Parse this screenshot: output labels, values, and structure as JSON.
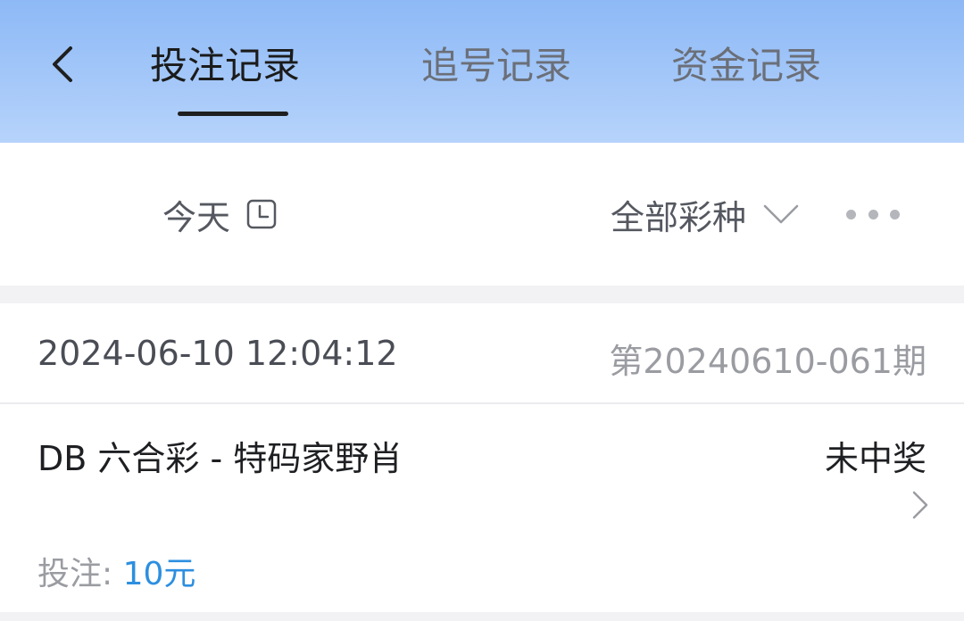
{
  "header": {
    "tabs": [
      {
        "label": "投注记录",
        "active": true
      },
      {
        "label": "追号记录",
        "active": false
      },
      {
        "label": "资金记录",
        "active": false
      }
    ],
    "back_icon": "chevron-left-icon"
  },
  "filters": {
    "date_label": "今天",
    "date_icon": "clock-icon",
    "lottery_type_label": "全部彩种",
    "lottery_type_icon": "chevron-down-icon",
    "more_icon": "more-dots-icon"
  },
  "records": [
    {
      "time": "2024-06-10 12:04:12",
      "issue": "第20240610-061期",
      "lottery": "DB 六合彩 - 特码家野肖",
      "status": "未中奖",
      "bet_label": "投注: ",
      "bet_amount": "10元"
    }
  ],
  "colors": {
    "header_gradient_top": "#8db9f6",
    "header_gradient_bottom": "#b6d3fb",
    "accent_blue": "#2d8fe0"
  }
}
